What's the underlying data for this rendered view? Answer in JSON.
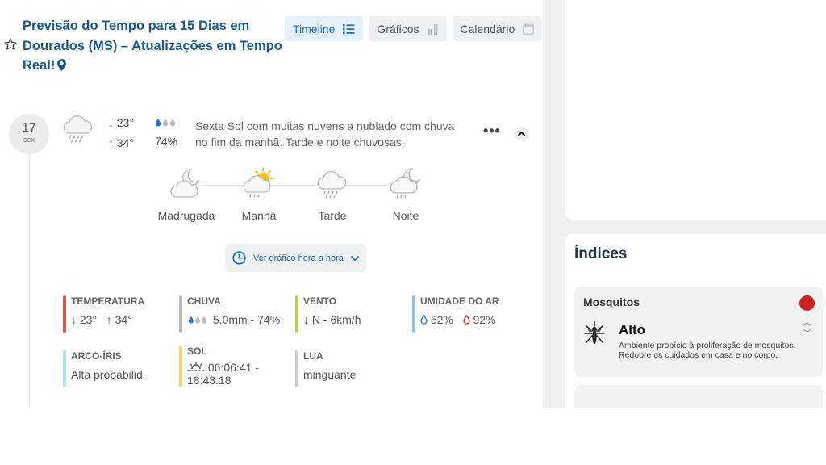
{
  "header": {
    "title": "Previsão do Tempo para 15 Dias em Dourados (MS) – Atualizações em Tempo Real!",
    "tabs": [
      {
        "label": "Timeline",
        "icon": "list-icon",
        "active": true
      },
      {
        "label": "Gráficos",
        "icon": "bar-chart-icon",
        "active": false
      },
      {
        "label": "Calendário",
        "icon": "calendar-icon",
        "active": false
      }
    ]
  },
  "day": {
    "date_num": "17",
    "weekday": "sex",
    "icon": "cloud-rain-icon",
    "temp_min": "23°",
    "temp_max": "34°",
    "rain_chance": "74%",
    "summary": "Sexta Sol com muitas nuvens a nublado com chuva no fim da manhã. Tarde e noite chuvosas.",
    "more_label": "•••"
  },
  "periods": [
    {
      "label": "Madrugada",
      "icon": "moon-cloud-icon"
    },
    {
      "label": "Manhã",
      "icon": "sun-cloud-rain-icon"
    },
    {
      "label": "Tarde",
      "icon": "cloud-rain-icon"
    },
    {
      "label": "Noite",
      "icon": "moon-cloud-rain-icon"
    }
  ],
  "hourly_button": {
    "label": "Ver gráfico hora a hora"
  },
  "details": {
    "temperatura": {
      "title": "TEMPERATURA",
      "min": "23°",
      "max": "34°",
      "color": "#d9534f"
    },
    "chuva": {
      "title": "CHUVA",
      "value": "5.0mm - 74%",
      "color": "#b8b8b8"
    },
    "vento": {
      "title": "VENTO",
      "value": "N - 6km/h",
      "color": "#b5cf52"
    },
    "umidade": {
      "title": "UMIDADE DO AR",
      "min": "52%",
      "max": "92%",
      "color": "#8ec3ee"
    },
    "arco_iris": {
      "title": "ARCO-ÍRIS",
      "value": "Alta probabilid.",
      "color": "#aee3ef"
    },
    "sol": {
      "title": "SOL",
      "value": "06:06:41 - 18:43:18",
      "color": "#f3d36a"
    },
    "lua": {
      "title": "LUA",
      "value": "minguante",
      "color": "#c9cdd2"
    }
  },
  "indices": {
    "title": "Índices",
    "mosquitos": {
      "name": "Mosquitos",
      "level": "Alto",
      "status_color": "#cc2222",
      "description": "Ambiente propício à proliferação de mosquitos. Redobre os cuidados em casa e no corpo."
    }
  }
}
